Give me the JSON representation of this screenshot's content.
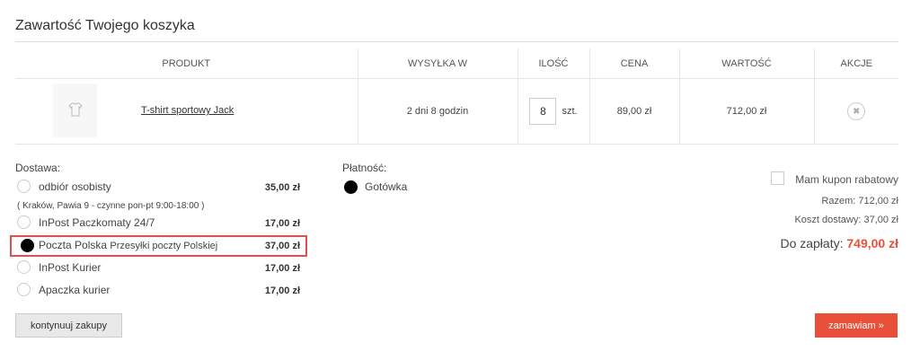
{
  "page": {
    "title": "Zawartość Twojego koszyka"
  },
  "cart": {
    "columns": {
      "product": "PRODUKT",
      "shipping": "WYSYŁKA W",
      "quantity": "ILOŚĆ",
      "price": "CENA",
      "value": "WARTOŚĆ",
      "actions": "AKCJE"
    },
    "item": {
      "name": "T-shirt sportowy Jack",
      "shipping_time": "2 dni 8 godzin",
      "quantity": "8",
      "unit": "szt.",
      "price": "89,00 zł",
      "value": "712,00 zł",
      "remove_glyph": "✖",
      "thumb_icon": "tshirt-icon"
    }
  },
  "delivery": {
    "label": "Dostawa:",
    "note": "( Kraków, Pawia 9 - czynne pon-pt 9:00-18:00 )",
    "options": [
      {
        "name": "odbiór osobisty",
        "price": "35,00 zł",
        "selected": false
      },
      {
        "name": "InPost Paczkomaty 24/7",
        "price": "17,00 zł",
        "selected": false
      },
      {
        "name": "Poczta Polska",
        "desc": "Przesyłki poczty Polskiej",
        "price": "37,00 zł",
        "selected": true
      },
      {
        "name": "InPost Kurier",
        "price": "17,00 zł",
        "selected": false
      },
      {
        "name": "Apaczka kurier",
        "price": "17,00 zł",
        "selected": false
      }
    ]
  },
  "payment": {
    "label": "Płatność:",
    "option": {
      "name": "Gotówka",
      "selected": true
    }
  },
  "summary": {
    "coupon_label": "Mam kupon rabatowy",
    "subtotal": "Razem: 712,00 zł",
    "shipping_cost": "Koszt dostawy: 37,00 zł",
    "total_label": "Do zapłaty:",
    "total_value": "749,00 zł"
  },
  "buttons": {
    "continue": "kontynuuj zakupy",
    "order": "zamawiam »"
  },
  "colors": {
    "accent": "#e8503a",
    "highlight": "#e05050"
  }
}
